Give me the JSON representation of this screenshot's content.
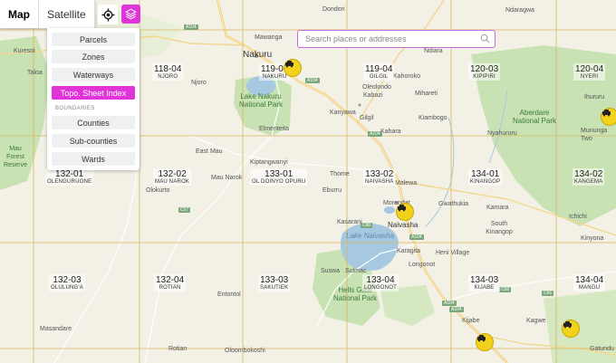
{
  "map_type_tabs": [
    {
      "label": "Map",
      "active": true
    },
    {
      "label": "Satellite",
      "active": false
    }
  ],
  "layer_panel": {
    "items": [
      {
        "label": "Parcels",
        "active": false
      },
      {
        "label": "Zones",
        "active": false
      },
      {
        "label": "Waterways",
        "active": false
      },
      {
        "label": "Topo. Sheet Index",
        "active": true
      }
    ],
    "section_label": "BOUNDARIES",
    "boundary_items": [
      {
        "label": "Counties"
      },
      {
        "label": "Sub-counties"
      },
      {
        "label": "Wards"
      }
    ]
  },
  "search": {
    "placeholder": "Search places or addresses"
  },
  "colors": {
    "accent": "#e034d8",
    "grid_line": "#d9b75a",
    "water": "#a6c8e0",
    "park": "#c8e2b0",
    "pin": "#f2d21b"
  },
  "icons": {
    "locate": "crosshair-icon",
    "layers": "layers-icon",
    "search": "search-icon",
    "pin": "cars-pin-icon"
  },
  "sheets": [
    {
      "number": "118-04",
      "name": "NJORO"
    },
    {
      "number": "119-03",
      "name": "NAKURU"
    },
    {
      "number": "119-04",
      "name": "GILGIL"
    },
    {
      "number": "120-03",
      "name": "KIPIPIRI"
    },
    {
      "number": "120-04",
      "name": "NYERI"
    },
    {
      "number": "132-01",
      "name": "OLENGURUONE"
    },
    {
      "number": "132-02",
      "name": "MAU NAROK"
    },
    {
      "number": "133-01",
      "name": "OL DOINYO OPURU"
    },
    {
      "number": "133-02",
      "name": "NAIVASHA"
    },
    {
      "number": "134-01",
      "name": "KINANGOP"
    },
    {
      "number": "134-02",
      "name": "KANGEMA"
    },
    {
      "number": "132-03",
      "name": "OLULUNG'A"
    },
    {
      "number": "132-04",
      "name": "ROTIAN"
    },
    {
      "number": "133-03",
      "name": "SAKUTIEK"
    },
    {
      "number": "133-04",
      "name": "LONGONOT"
    },
    {
      "number": "134-03",
      "name": "KIJABE"
    },
    {
      "number": "134-04",
      "name": "MANGU"
    }
  ],
  "places": [
    {
      "name": "Dondori"
    },
    {
      "name": "Ndaragwa"
    },
    {
      "name": "Mawanga"
    },
    {
      "name": "Nakuru"
    },
    {
      "name": "Ndiara"
    },
    {
      "name": "Kuresoi"
    },
    {
      "name": "Taloa"
    },
    {
      "name": "Njoro"
    },
    {
      "name": "Kahoroko"
    },
    {
      "name": "Oleolondo"
    },
    {
      "name": "Kabazi"
    },
    {
      "name": "Mihareti"
    },
    {
      "name": "Kanyawa"
    },
    {
      "name": "Gilgil"
    },
    {
      "name": "Ihururu"
    },
    {
      "name": "Kiambogo"
    },
    {
      "name": "Kahara"
    },
    {
      "name": "Elmenteita"
    },
    {
      "name": "Nyahururu"
    },
    {
      "name": "Mununga"
    },
    {
      "name": "Two"
    },
    {
      "name": "East Mau"
    },
    {
      "name": "Kiptangwanyi"
    },
    {
      "name": "Mau Narok"
    },
    {
      "name": "Thome"
    },
    {
      "name": "Olokurto"
    },
    {
      "name": "Eburru"
    },
    {
      "name": "Malewa"
    },
    {
      "name": "Morendat"
    },
    {
      "name": "Gwathukia"
    },
    {
      "name": "Kasarani"
    },
    {
      "name": "Naivasha"
    },
    {
      "name": "South Kinangop"
    },
    {
      "name": "Ichichi"
    },
    {
      "name": "Kinyona"
    },
    {
      "name": "Karagita"
    },
    {
      "name": "Heni Village"
    },
    {
      "name": "Longonot"
    },
    {
      "name": "Suswa"
    },
    {
      "name": "Entontol"
    },
    {
      "name": "Masandare"
    },
    {
      "name": "Rotian"
    },
    {
      "name": "Oloombokoshi"
    },
    {
      "name": "Kijabe"
    },
    {
      "name": "Kagwe"
    },
    {
      "name": "Gatundu"
    },
    {
      "name": "Sulmac"
    },
    {
      "name": "Kamara"
    }
  ],
  "parks": [
    {
      "name": "Lake Nakuru National Park"
    },
    {
      "name": "Aberdare National Park"
    },
    {
      "name": "Hells Gate National Park"
    },
    {
      "name": "Mau Forest Reserve"
    }
  ],
  "lakes": [
    {
      "name": "Lake Naivasha"
    }
  ],
  "road_labels": [
    "A104",
    "A104",
    "A104",
    "C57",
    "C88",
    "A104",
    "A104",
    "C68",
    "A104",
    "C66"
  ]
}
